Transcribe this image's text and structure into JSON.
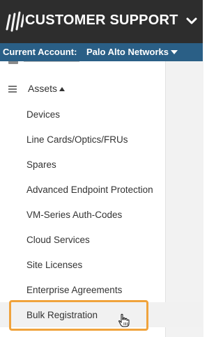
{
  "header": {
    "title": "CUSTOMER SUPPORT",
    "logo_icon": "brand-logo-icon",
    "chevron_icon": "chevron-down-icon",
    "colors": {
      "background": "#2d2d2d",
      "text": "#ffffff"
    }
  },
  "account_bar": {
    "label": "Current Account:",
    "value": "Palo Alto Networks",
    "caret_icon": "caret-down-icon",
    "colors": {
      "background": "#2a5f86",
      "text": "#ffffff"
    }
  },
  "sidebar": {
    "section": {
      "label": "Assets",
      "icon": "list-icon",
      "caret_icon": "caret-up-icon"
    },
    "items": [
      {
        "label": "Devices"
      },
      {
        "label": "Line Cards/Optics/FRUs"
      },
      {
        "label": "Spares"
      },
      {
        "label": "Advanced Endpoint Protection"
      },
      {
        "label": "VM-Series Auth-Codes"
      },
      {
        "label": "Cloud Services"
      },
      {
        "label": "Site Licenses"
      },
      {
        "label": "Enterprise Agreements"
      },
      {
        "label": "Bulk Registration",
        "highlighted": true
      }
    ],
    "highlight_color": "#f0a33c"
  }
}
